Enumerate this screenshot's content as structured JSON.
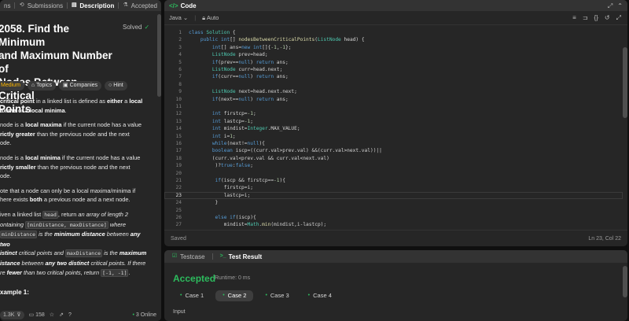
{
  "left_tabs": {
    "description_prefix": "ns",
    "submissions": "Submissions",
    "description": "Description",
    "accepted": "Accepted"
  },
  "problem": {
    "title": "2058. Find the Minimum and Maximum Number of Nodes Between Critical Points",
    "title_lines": [
      "2058. Find the Minimum",
      "and Maximum Number of",
      "Nodes Between Critical",
      "Points"
    ],
    "status": "Solved",
    "difficulty": "Medium",
    "topics": "Topics",
    "companies": "Companies",
    "hint": "Hint",
    "example_heading": "xample 1:"
  },
  "description": {
    "p1": [
      "critical point",
      " in a linked list is defined as ",
      "either",
      " a ",
      "local",
      "axima",
      " or a ",
      "local minima",
      "."
    ],
    "p2": [
      "node is a ",
      "local maxima",
      " if the current node has a value ",
      "rictly greater",
      " than the previous node and the next ",
      "ode."
    ],
    "p3": [
      "node is a ",
      "local minima",
      " if the current node has a value ",
      "rictly smaller",
      " than the previous node and the next ",
      "ode."
    ],
    "p4": [
      "ote that a node can only be a local maxima/minima if ",
      "here exists ",
      "both",
      " a previous node and a next node."
    ],
    "p5": [
      "iven a linked list ",
      "head",
      ", return ",
      "an array of length 2",
      "ontaining ",
      "[minDistance, maxDistance]",
      " where ",
      "minDistance",
      " is the ",
      "minimum distance",
      " between ",
      "any two",
      "istinct",
      " critical points and ",
      "maxDistance",
      " is the ",
      "maximum",
      "istance",
      " between ",
      "any two distinct",
      " critical points. If there ",
      "re ",
      "fewer",
      " than two critical points, return ",
      "[-1, -1]",
      "."
    ]
  },
  "left_footer": {
    "likes": "1.3K",
    "comments": "158",
    "online": "3 Online"
  },
  "code_panel": {
    "title": "Code",
    "language": "Java",
    "mode": "Auto",
    "status": "Saved",
    "cursor": "Ln 23, Col 22",
    "current_line": 23,
    "lines": [
      "class Solution {",
      "    public int[] nodesBetweenCriticalPoints(ListNode head) {",
      "        int[] ans=new int[]{-1,-1};",
      "        ListNode prev=head;",
      "        if(prev==null) return ans;",
      "        ListNode curr=head.next;",
      "        if(curr==null) return ans;",
      "",
      "        ListNode next=head.next.next;",
      "        if(next==null) return ans;",
      "",
      "        int firstcp=-1;",
      "        int lastcp=-1;",
      "        int mindist=Integer.MAX_VALUE;",
      "        int i=1;",
      "        while(next!=null){",
      "        boolean iscp=((curr.val>prev.val) &&(curr.val>next.val))||",
      "        (curr.val<prev.val && curr.val<next.val)",
      "         )?true:false;",
      "",
      "         if(iscp && firstcp==-1){",
      "            firstcp=i;",
      "            lastcp=i;",
      "         }",
      "",
      "         else if(iscp){",
      "            mindist=Math.min(mindist,i-lastcp);"
    ]
  },
  "result_panel": {
    "testcase_tab": "Testcase",
    "result_tab": "Test Result",
    "verdict": "Accepted",
    "runtime": "Runtime: 0 ms",
    "cases": [
      "Case 1",
      "Case 2",
      "Case 3",
      "Case 4"
    ],
    "selected_case": 1,
    "input_label": "Input"
  },
  "colors": {
    "accent_green": "#2cbb5d",
    "medium": "#ffb800",
    "panel_bg": "#262626"
  }
}
